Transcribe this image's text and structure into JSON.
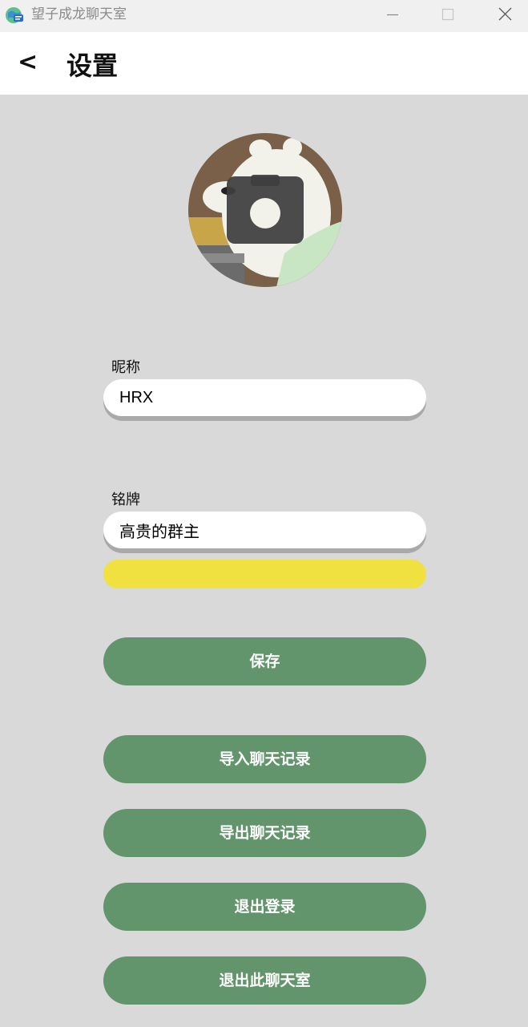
{
  "window": {
    "title": "望子成龙聊天室"
  },
  "header": {
    "back_label": "<",
    "title": "设置"
  },
  "avatar": {
    "icon": "camera-icon"
  },
  "nickname": {
    "label": "昵称",
    "value": "HRX"
  },
  "badge": {
    "label": "铭牌",
    "value": "高贵的群主",
    "color": "#f0e040"
  },
  "buttons": {
    "save": "保存",
    "import_history": "导入聊天记录",
    "export_history": "导出聊天记录",
    "logout": "退出登录",
    "leave_room": "退出此聊天室"
  },
  "colors": {
    "background": "#d9d9d9",
    "button": "#62956c",
    "header": "#ffffff"
  }
}
